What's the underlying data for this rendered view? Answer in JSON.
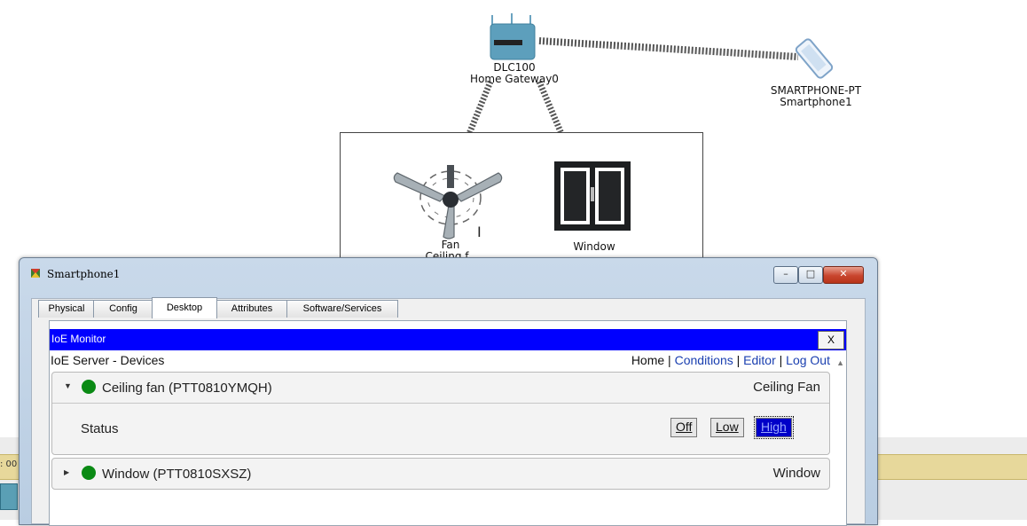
{
  "canvas": {
    "gateway_model": "DLC100",
    "gateway_name": "Home Gateway0",
    "smartphone_model": "SMARTPHONE-PT",
    "smartphone_name": "Smartphone1",
    "fan_label": "Fan",
    "fan_label_cut": "Ceiling f",
    "window_label": "Window",
    "left_time": ": 00"
  },
  "window": {
    "title": "Smartphone1",
    "controls": {
      "minimize": "–",
      "maximize": "□",
      "close": "✕"
    }
  },
  "tabs": [
    {
      "label": "Physical"
    },
    {
      "label": "Config"
    },
    {
      "label": "Desktop",
      "active": true
    },
    {
      "label": "Attributes"
    },
    {
      "label": "Software/Services"
    }
  ],
  "ioe": {
    "header": "IoE Monitor",
    "close_label": "X",
    "subtitle": "IoE Server - Devices",
    "nav": {
      "home": "Home",
      "conditions": "Conditions",
      "editor": "Editor",
      "logout": "Log Out",
      "sep": " | "
    }
  },
  "devices": [
    {
      "name": "Ceiling fan (PTT0810YMQH)",
      "type": "Ceiling Fan",
      "expanded": true,
      "status_label": "Status",
      "options": [
        "Off",
        "Low",
        "High"
      ],
      "selected": "High"
    },
    {
      "name": "Window (PTT0810SXSZ)",
      "type": "Window",
      "expanded": false
    }
  ],
  "colors": {
    "ioe_header": "#0000ff",
    "status_dot": "#0a8a14",
    "link": "#1a3fb0",
    "active_option": "#0000c8"
  }
}
